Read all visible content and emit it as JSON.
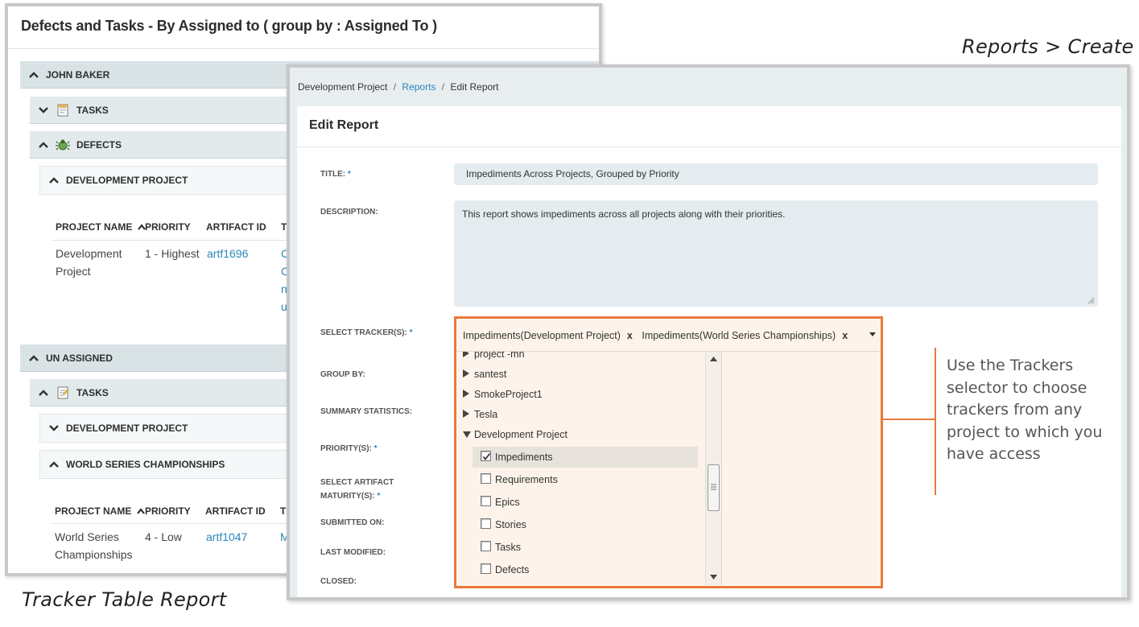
{
  "captions": {
    "top_right": "Reports > Create",
    "bottom_left": "Tracker Table Report"
  },
  "tracker_report": {
    "title": "Defects and Tasks - By Assigned to ( group by : Assigned To )",
    "groups": [
      {
        "label": "JOHN BAKER"
      },
      {
        "label": "TASKS"
      },
      {
        "label": "DEFECTS"
      },
      {
        "label": "DEVELOPMENT PROJECT"
      },
      {
        "label": "UN ASSIGNED"
      },
      {
        "label": "TASKS"
      },
      {
        "label": "DEVELOPMENT PROJECT"
      },
      {
        "label": "WORLD SERIES CHAMPIONSHIPS"
      }
    ],
    "columns": [
      "PROJECT NAME",
      "PRIORITY",
      "ARTIFACT ID",
      "T"
    ],
    "rows_dev": {
      "project_line1": "Development",
      "project_line2": "Project",
      "priority": "1 - Highest",
      "artifact_id": "artf1696",
      "title_fragments": [
        "C",
        "C",
        "n",
        "u"
      ]
    },
    "rows_ws": {
      "project_line1": "World Series",
      "project_line2": "Championships",
      "priority": "4 - Low",
      "artifact_id": "artf1047",
      "title_fragment": "M"
    },
    "colors": {
      "link": "#2a86b8",
      "group_bg": "#d9e3e6"
    }
  },
  "edit_report": {
    "breadcrumb": {
      "project": "Development Project",
      "sep": "/",
      "reports": "Reports",
      "current": "Edit Report"
    },
    "header": "Edit Report",
    "fields": {
      "title_label": "TITLE:",
      "title_value": "Impediments Across Projects, Grouped by Priority",
      "description_label": "DESCRIPTION:",
      "description_value": "This report shows impediments across all projects along with their priorities.",
      "trackers_label": "SELECT TRACKER(S):",
      "group_by_label": "GROUP BY:",
      "summary_label": "SUMMARY STATISTICS:",
      "priority_label": "PRIORITY(S):",
      "maturity_label_1": "SELECT ARTIFACT",
      "maturity_label_2": "MATURITY(S):",
      "submitted_label": "SUBMITTED ON:",
      "modified_label": "LAST MODIFIED:",
      "closed_label": "CLOSED:",
      "required_mark": "*"
    },
    "tracker_selector": {
      "selected": [
        "Impediments(Development Project)",
        "Impediments(World Series Championships)"
      ],
      "remove_glyph": "x",
      "caret_icon": "caret-down-icon",
      "tree": [
        {
          "label": "project -mn",
          "expanded": false
        },
        {
          "label": "santest",
          "expanded": false
        },
        {
          "label": "SmokeProject1",
          "expanded": false
        },
        {
          "label": "Tesla",
          "expanded": false
        },
        {
          "label": "Development Project",
          "expanded": true
        }
      ],
      "children": [
        {
          "label": "Impediments",
          "checked": true
        },
        {
          "label": "Requirements",
          "checked": false
        },
        {
          "label": "Epics",
          "checked": false
        },
        {
          "label": "Stories",
          "checked": false
        },
        {
          "label": "Tasks",
          "checked": false
        },
        {
          "label": "Defects",
          "checked": false
        }
      ],
      "colors": {
        "highlight_border": "#e87a3a",
        "background": "#fdf3ea"
      }
    }
  },
  "callout": {
    "text": "Use the Trackers selector to choose trackers from any project to which you have access"
  }
}
